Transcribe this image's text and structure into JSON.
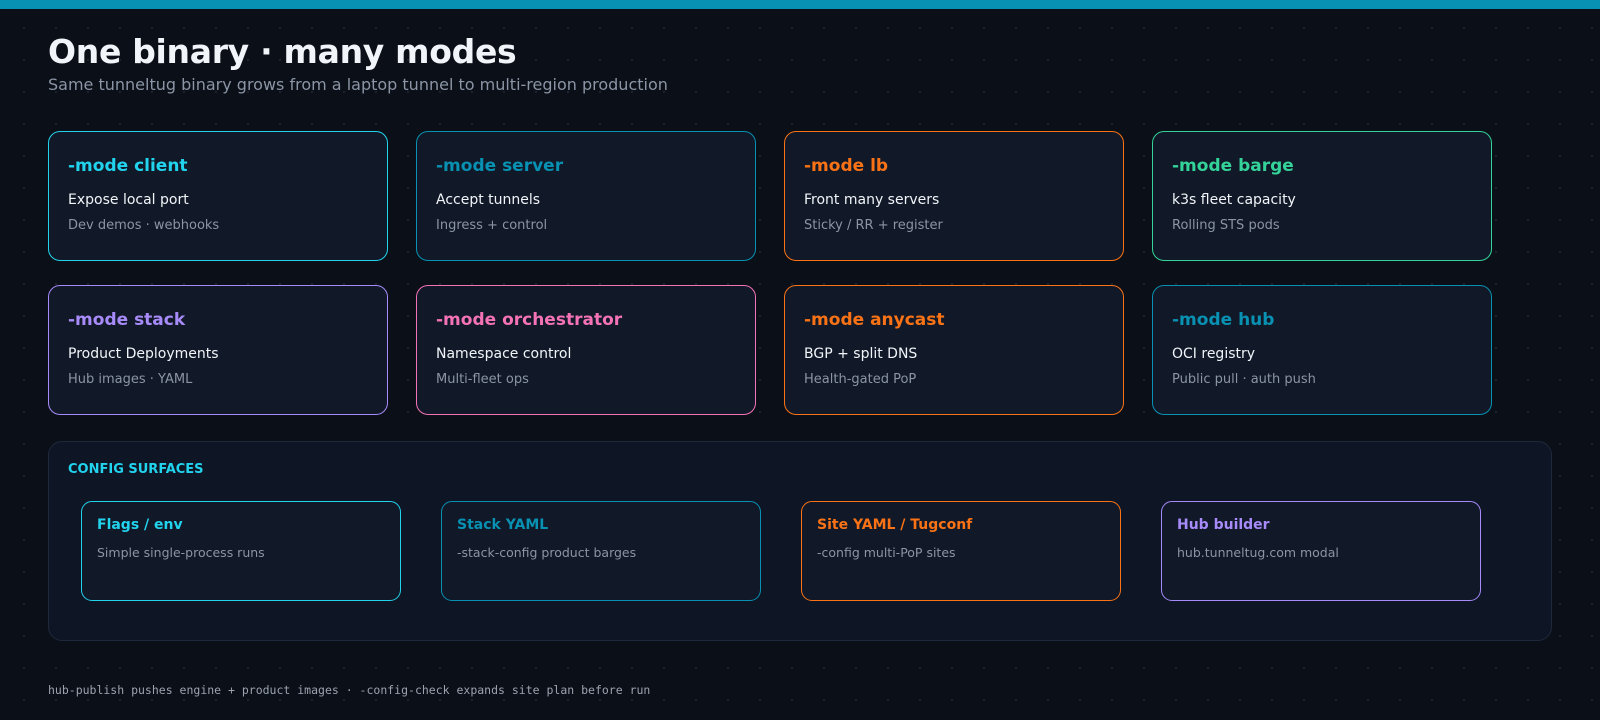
{
  "header": {
    "title": "One binary · many modes",
    "subtitle": "Same tunneltug binary grows from a laptop tunnel to multi-region production"
  },
  "modes": [
    {
      "name": "-mode client",
      "desc": "Expose local port",
      "note": "Dev demos · webhooks",
      "color": "#22d3ee"
    },
    {
      "name": "-mode server",
      "desc": "Accept tunnels",
      "note": "Ingress + control",
      "color": "#0891b2"
    },
    {
      "name": "-mode lb",
      "desc": "Front many servers",
      "note": "Sticky / RR + register",
      "color": "#f97316"
    },
    {
      "name": "-mode barge",
      "desc": "k3s fleet capacity",
      "note": "Rolling STS pods",
      "color": "#34d399"
    },
    {
      "name": "-mode stack",
      "desc": "Product Deployments",
      "note": "Hub images · YAML",
      "color": "#a78bfa"
    },
    {
      "name": "-mode orchestrator",
      "desc": "Namespace control",
      "note": "Multi-fleet ops",
      "color": "#f472b6"
    },
    {
      "name": "-mode anycast",
      "desc": "BGP + split DNS",
      "note": "Health-gated PoP",
      "color": "#f97316"
    },
    {
      "name": "-mode hub",
      "desc": "OCI registry",
      "note": "Public pull · auth push",
      "color": "#0891b2"
    }
  ],
  "config": {
    "heading": "CONFIG SURFACES",
    "surfaces": [
      {
        "name": "Flags / env",
        "desc": "Simple single-process runs",
        "color": "#22d3ee"
      },
      {
        "name": "Stack YAML",
        "desc": "-stack-config product barges",
        "color": "#0891b2"
      },
      {
        "name": "Site YAML / Tugconf",
        "desc": "-config multi-PoP sites",
        "color": "#f97316"
      },
      {
        "name": "Hub builder",
        "desc": "hub.tunneltug.com modal",
        "color": "#a78bfa"
      }
    ]
  },
  "footer": "hub-publish pushes engine + product images · -config-check expands site plan before run"
}
